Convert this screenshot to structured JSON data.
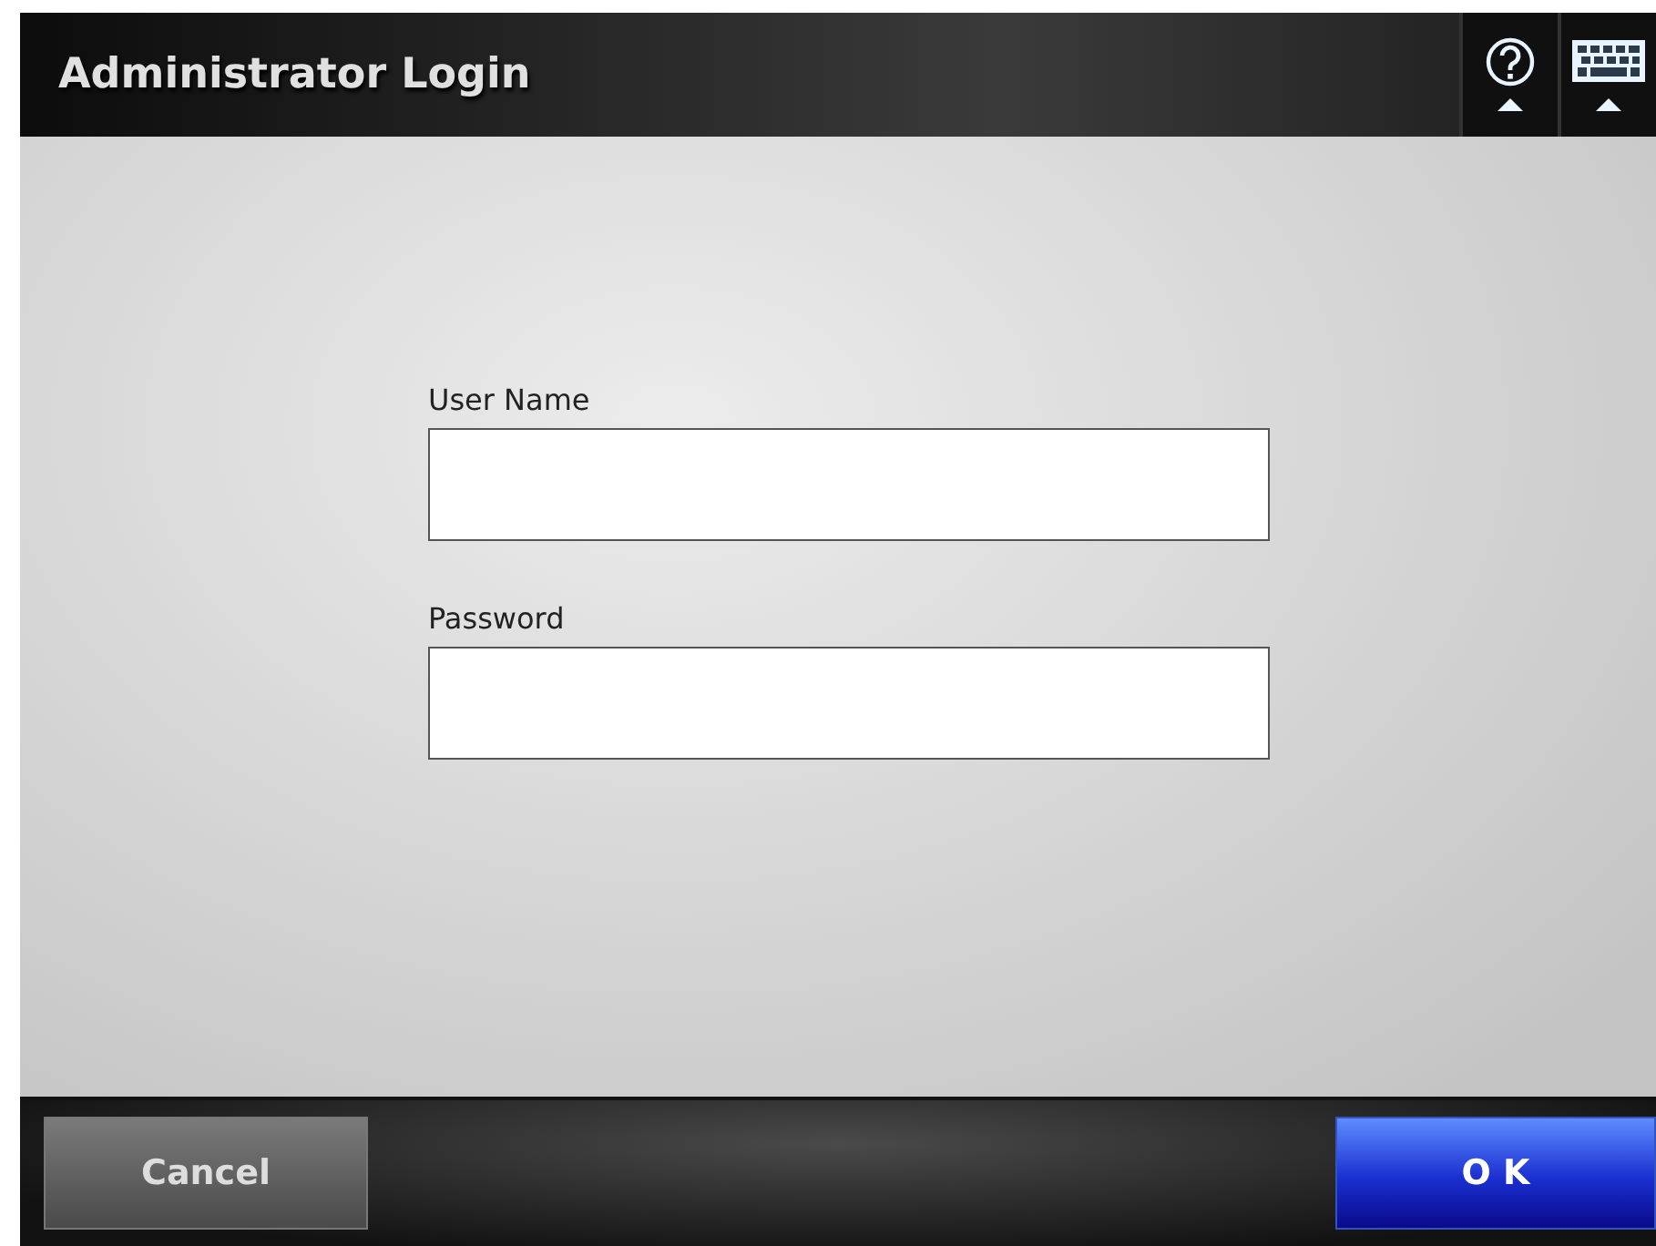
{
  "window": {
    "title": "Administrator Login"
  },
  "fields": [
    {
      "label": "User Name"
    },
    {
      "label": "Password"
    }
  ],
  "buttons": {
    "cancel": "Cancel",
    "ok": "O K"
  }
}
